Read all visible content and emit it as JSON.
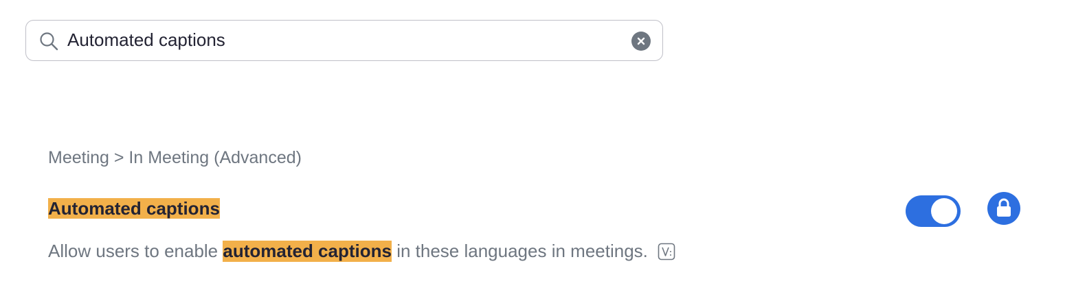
{
  "search": {
    "value": "Automated captions",
    "icon": "search-icon",
    "clear_icon": "clear-icon"
  },
  "result": {
    "breadcrumb": "Meeting > In Meeting (Advanced)",
    "title": "Automated captions",
    "description_before": "Allow users to enable ",
    "description_highlight": "automated captions",
    "description_after": " in these languages in meetings.",
    "version_icon": "version-icon",
    "toggle_enabled": true,
    "lock_icon": "lock-icon"
  },
  "colors": {
    "accent": "#2d6fe0",
    "highlight": "#f2b04a",
    "text_primary": "#232333",
    "text_secondary": "#6e7680"
  }
}
